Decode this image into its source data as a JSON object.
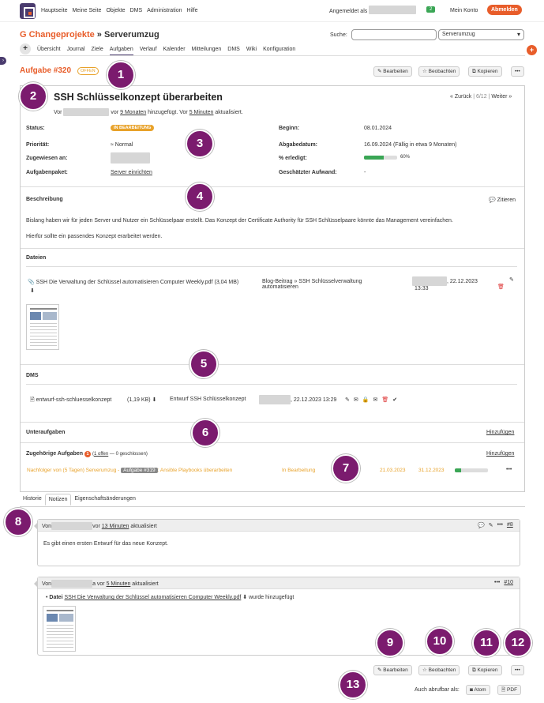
{
  "topnav": [
    "Hauptseite",
    "Meine Seite",
    "Objekte",
    "DMS",
    "Administration",
    "Hilfe"
  ],
  "login_label": "Angemeldet als",
  "notification_count": "2",
  "my_account": "Mein Konto",
  "logout": "Abmelden",
  "project": {
    "part1": "G Changeprojekte",
    "sep": " » ",
    "part2": "Serverumzug"
  },
  "search": {
    "label": "Suche:",
    "scope": "Serverumzug"
  },
  "menu": {
    "tabs": [
      "Übersicht",
      "Journal",
      "Ziele",
      "Aufgaben",
      "Verlauf",
      "Kalender",
      "Mitteilungen",
      "DMS",
      "Wiki",
      "Konfiguration"
    ],
    "active": "Aufgaben"
  },
  "issue": {
    "id": "Aufgabe #320",
    "state": "OFFEN",
    "subject": "SSH Schlüsselkonzept überarbeiten",
    "added_prefix": "Vor",
    "added_mid": "vor",
    "added_time": "9 Monaten",
    "added_suffix": "hinzugefügt. Vor",
    "updated_time": "5 Minuten",
    "updated_suffix": "aktualisiert.",
    "prev": "« Zurück",
    "position": "6/12",
    "next": "Weiter »"
  },
  "actions": {
    "edit": "Bearbeiten",
    "watch": "Beobachten",
    "copy": "Kopieren",
    "more": "•••"
  },
  "attributes": {
    "status_label": "Status:",
    "status": "IN BEARBEITUNG",
    "priority_label": "Priorität:",
    "priority": "Normal",
    "assigned_label": "Zugewiesen an:",
    "package_label": "Aufgabenpaket:",
    "package": "Server einrichten",
    "start_label": "Beginn:",
    "start": "08.01.2024",
    "due_label": "Abgabedatum:",
    "due": "16.09.2024 (Fällig in etwa 9 Monaten)",
    "done_label": "% erledigt:",
    "done": "60%",
    "done_fraction": 0.6,
    "estimate_label": "Geschätzter Aufwand:",
    "estimate": "-"
  },
  "description": {
    "title": "Beschreibung",
    "quote": "Zitieren",
    "p1": "Bislang haben wir für jeden Server und Nutzer ein Schlüsselpaar erstellt. Das Konzept der Certificate Authority für SSH Schlüsselpaare könnte das Management vereinfachen.",
    "p2": "Hierfür sollte ein passendes Konzept erarbeitet werden."
  },
  "files": {
    "title": "Dateien",
    "name": "SSH Die Verwaltung der Schlüssel automatisieren Computer Weekly.pdf",
    "size": "(3,04 MB)",
    "desc_line1": "Blog-Beitrag » SSH Schlüsselverwaltung",
    "desc_line2": "automatisieren",
    "date": ", 22.12.2023",
    "time": "13:33"
  },
  "dms": {
    "title": "DMS",
    "name": "entwurf-ssh-schluesselkonzept",
    "size": "(1,19 KB)",
    "desc": "Entwurf SSH Schlüsselkonzept",
    "date": ", 22.12.2023 13:29"
  },
  "subtasks": {
    "title": "Unteraufgaben",
    "add": "Hinzufügen"
  },
  "related": {
    "title": "Zugehörige Aufgaben",
    "count": "1",
    "open_link": "1 offen",
    "closed": " — 0 geschlossen)",
    "open_paren": "(",
    "add": "Hinzufügen",
    "relation": "Nachfolger von (5 Tagen) Serverumzug -",
    "issue_ref": "Aufgabe #319",
    "subject": ": Ansible Playbooks überarbeiten",
    "status": "In Bearbeitung",
    "start": "21.03.2023",
    "end": "31.12.2023",
    "progress_fraction": 0.2,
    "more": "•••"
  },
  "history_tabs": [
    "Historie",
    "Notizen",
    "Eigenschaftsänderungen"
  ],
  "history_active": "Notizen",
  "notes": [
    {
      "prefix": "Von",
      "mid": "vor",
      "time": "13 Minuten",
      "suffix": "aktualisiert",
      "ref": "#8",
      "text": "Es gibt einen ersten Entwurf für das neue Konzept."
    },
    {
      "prefix": "Von",
      "mid": "a vor",
      "time": "5 Minuten",
      "suffix": "aktualisiert",
      "ref": "#10",
      "detail_label": "Datei",
      "detail_file": "SSH Die Verwaltung der Schlüssel automatisieren Computer Weekly.pdf",
      "detail_suffix": "wurde hinzugefügt"
    }
  ],
  "export": {
    "label": "Auch abrufbar als:",
    "atom": "Atom",
    "pdf": "PDF"
  },
  "callouts": [
    "1",
    "2",
    "3",
    "4",
    "5",
    "6",
    "7",
    "8",
    "9",
    "10",
    "11",
    "12",
    "13"
  ],
  "colors": {
    "accent": "#e85d2a",
    "brand": "#4a3b6e",
    "warning": "#e8a22a",
    "success": "#3aa655",
    "callout": "#7b1b6e"
  }
}
